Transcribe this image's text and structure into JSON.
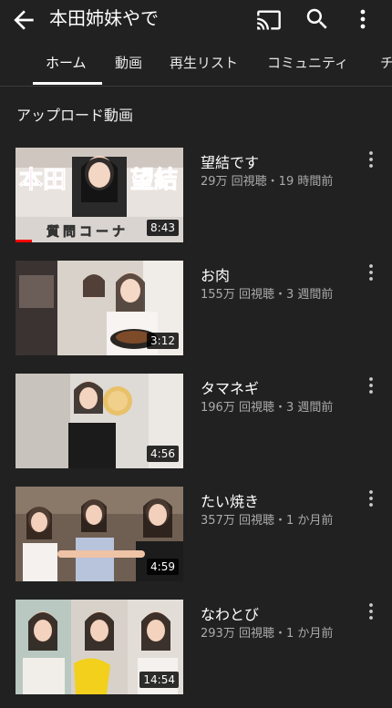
{
  "app_bar": {
    "title": "本田姉妹やで",
    "back_icon": "arrow-left-icon",
    "cast_icon": "cast-icon",
    "search_icon": "search-icon",
    "more_icon": "more-vertical-icon"
  },
  "tabs": [
    {
      "label": "ホーム",
      "active": true
    },
    {
      "label": "動画",
      "active": false
    },
    {
      "label": "再生リスト",
      "active": false
    },
    {
      "label": "コミュニティ",
      "active": false
    },
    {
      "label": "チ",
      "active": false
    }
  ],
  "section": {
    "title": "アップロード動画"
  },
  "videos": [
    {
      "title": "望結です",
      "meta": "29万 回視聴・19 時間前",
      "duration": "8:43",
      "thumb_text_left": "本田",
      "thumb_text_right": "望結",
      "thumb_caption": "質問コーナ",
      "watched": 0.1
    },
    {
      "title": "お肉",
      "meta": "155万 回視聴・3 週間前",
      "duration": "3:12"
    },
    {
      "title": "タマネギ",
      "meta": "196万 回視聴・3 週間前",
      "duration": "4:56"
    },
    {
      "title": "たい焼き",
      "meta": "357万 回視聴・1 か月前",
      "duration": "4:59"
    },
    {
      "title": "なわとび",
      "meta": "293万 回視聴・1 か月前",
      "duration": "14:54"
    }
  ],
  "colors": {
    "background": "#212121",
    "text_secondary": "#aaaaaa",
    "progress": "#ff0000",
    "thumb_text_pink": "#e4007f"
  }
}
